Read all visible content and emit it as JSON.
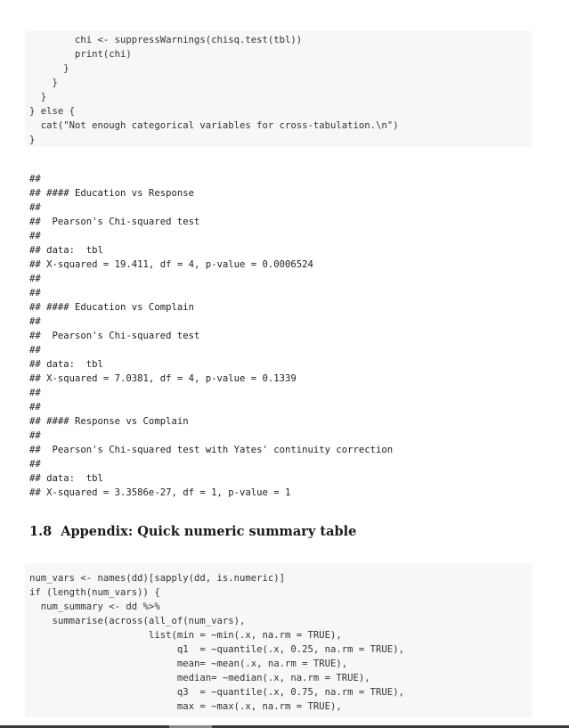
{
  "top_code_lines": [
    "        chi <- suppressWarnings(chisq.test(tbl))",
    "        print(chi)",
    "      }",
    "    }",
    "  }",
    "} else {",
    "  cat(\"Not enough categorical variables for cross-tabulation.\\n\")",
    "}"
  ],
  "output_lines": [
    "##",
    "## #### Education vs Response",
    "##",
    "##  Pearson's Chi-squared test",
    "##",
    "## data:  tbl",
    "## X-squared = 19.411, df = 4, p-value = 0.0006524",
    "##",
    "##",
    "## #### Education vs Complain",
    "##",
    "##  Pearson's Chi-squared test",
    "##",
    "## data:  tbl",
    "## X-squared = 7.0381, df = 4, p-value = 0.1339",
    "##",
    "##",
    "## #### Response vs Complain",
    "##",
    "##  Pearson's Chi-squared test with Yates' continuity correction",
    "##",
    "## data:  tbl",
    "## X-squared = 3.3586e-27, df = 1, p-value = 1"
  ],
  "section": {
    "number": "1.8",
    "title": "Appendix: Quick numeric summary table"
  },
  "bottom_code_lines": [
    "num_vars <- names(dd)[sapply(dd, is.numeric)]",
    "if (length(num_vars)) {",
    "  num_summary <- dd %>%",
    "    summarise(across(all_of(num_vars),",
    "                     list(min = ~min(.x, na.rm = TRUE),",
    "                          q1  = ~quantile(.x, 0.25, na.rm = TRUE),",
    "                          mean= ~mean(.x, na.rm = TRUE),",
    "                          median= ~median(.x, na.rm = TRUE),",
    "                          q3  = ~quantile(.x, 0.75, na.rm = TRUE),",
    "                          max = ~max(.x, na.rm = TRUE),"
  ]
}
